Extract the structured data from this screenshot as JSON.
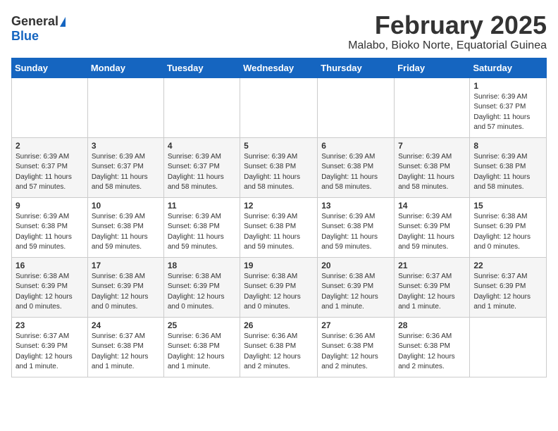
{
  "logo": {
    "general": "General",
    "blue": "Blue"
  },
  "title": "February 2025",
  "subtitle": "Malabo, Bioko Norte, Equatorial Guinea",
  "days_of_week": [
    "Sunday",
    "Monday",
    "Tuesday",
    "Wednesday",
    "Thursday",
    "Friday",
    "Saturday"
  ],
  "weeks": [
    [
      {
        "day": "",
        "info": ""
      },
      {
        "day": "",
        "info": ""
      },
      {
        "day": "",
        "info": ""
      },
      {
        "day": "",
        "info": ""
      },
      {
        "day": "",
        "info": ""
      },
      {
        "day": "",
        "info": ""
      },
      {
        "day": "1",
        "info": "Sunrise: 6:39 AM\nSunset: 6:37 PM\nDaylight: 11 hours\nand 57 minutes."
      }
    ],
    [
      {
        "day": "2",
        "info": "Sunrise: 6:39 AM\nSunset: 6:37 PM\nDaylight: 11 hours\nand 57 minutes."
      },
      {
        "day": "3",
        "info": "Sunrise: 6:39 AM\nSunset: 6:37 PM\nDaylight: 11 hours\nand 58 minutes."
      },
      {
        "day": "4",
        "info": "Sunrise: 6:39 AM\nSunset: 6:37 PM\nDaylight: 11 hours\nand 58 minutes."
      },
      {
        "day": "5",
        "info": "Sunrise: 6:39 AM\nSunset: 6:38 PM\nDaylight: 11 hours\nand 58 minutes."
      },
      {
        "day": "6",
        "info": "Sunrise: 6:39 AM\nSunset: 6:38 PM\nDaylight: 11 hours\nand 58 minutes."
      },
      {
        "day": "7",
        "info": "Sunrise: 6:39 AM\nSunset: 6:38 PM\nDaylight: 11 hours\nand 58 minutes."
      },
      {
        "day": "8",
        "info": "Sunrise: 6:39 AM\nSunset: 6:38 PM\nDaylight: 11 hours\nand 58 minutes."
      }
    ],
    [
      {
        "day": "9",
        "info": "Sunrise: 6:39 AM\nSunset: 6:38 PM\nDaylight: 11 hours\nand 59 minutes."
      },
      {
        "day": "10",
        "info": "Sunrise: 6:39 AM\nSunset: 6:38 PM\nDaylight: 11 hours\nand 59 minutes."
      },
      {
        "day": "11",
        "info": "Sunrise: 6:39 AM\nSunset: 6:38 PM\nDaylight: 11 hours\nand 59 minutes."
      },
      {
        "day": "12",
        "info": "Sunrise: 6:39 AM\nSunset: 6:38 PM\nDaylight: 11 hours\nand 59 minutes."
      },
      {
        "day": "13",
        "info": "Sunrise: 6:39 AM\nSunset: 6:38 PM\nDaylight: 11 hours\nand 59 minutes."
      },
      {
        "day": "14",
        "info": "Sunrise: 6:39 AM\nSunset: 6:39 PM\nDaylight: 11 hours\nand 59 minutes."
      },
      {
        "day": "15",
        "info": "Sunrise: 6:38 AM\nSunset: 6:39 PM\nDaylight: 12 hours\nand 0 minutes."
      }
    ],
    [
      {
        "day": "16",
        "info": "Sunrise: 6:38 AM\nSunset: 6:39 PM\nDaylight: 12 hours\nand 0 minutes."
      },
      {
        "day": "17",
        "info": "Sunrise: 6:38 AM\nSunset: 6:39 PM\nDaylight: 12 hours\nand 0 minutes."
      },
      {
        "day": "18",
        "info": "Sunrise: 6:38 AM\nSunset: 6:39 PM\nDaylight: 12 hours\nand 0 minutes."
      },
      {
        "day": "19",
        "info": "Sunrise: 6:38 AM\nSunset: 6:39 PM\nDaylight: 12 hours\nand 0 minutes."
      },
      {
        "day": "20",
        "info": "Sunrise: 6:38 AM\nSunset: 6:39 PM\nDaylight: 12 hours\nand 1 minute."
      },
      {
        "day": "21",
        "info": "Sunrise: 6:37 AM\nSunset: 6:39 PM\nDaylight: 12 hours\nand 1 minute."
      },
      {
        "day": "22",
        "info": "Sunrise: 6:37 AM\nSunset: 6:39 PM\nDaylight: 12 hours\nand 1 minute."
      }
    ],
    [
      {
        "day": "23",
        "info": "Sunrise: 6:37 AM\nSunset: 6:39 PM\nDaylight: 12 hours\nand 1 minute."
      },
      {
        "day": "24",
        "info": "Sunrise: 6:37 AM\nSunset: 6:38 PM\nDaylight: 12 hours\nand 1 minute."
      },
      {
        "day": "25",
        "info": "Sunrise: 6:36 AM\nSunset: 6:38 PM\nDaylight: 12 hours\nand 1 minute."
      },
      {
        "day": "26",
        "info": "Sunrise: 6:36 AM\nSunset: 6:38 PM\nDaylight: 12 hours\nand 2 minutes."
      },
      {
        "day": "27",
        "info": "Sunrise: 6:36 AM\nSunset: 6:38 PM\nDaylight: 12 hours\nand 2 minutes."
      },
      {
        "day": "28",
        "info": "Sunrise: 6:36 AM\nSunset: 6:38 PM\nDaylight: 12 hours\nand 2 minutes."
      },
      {
        "day": "",
        "info": ""
      }
    ]
  ]
}
